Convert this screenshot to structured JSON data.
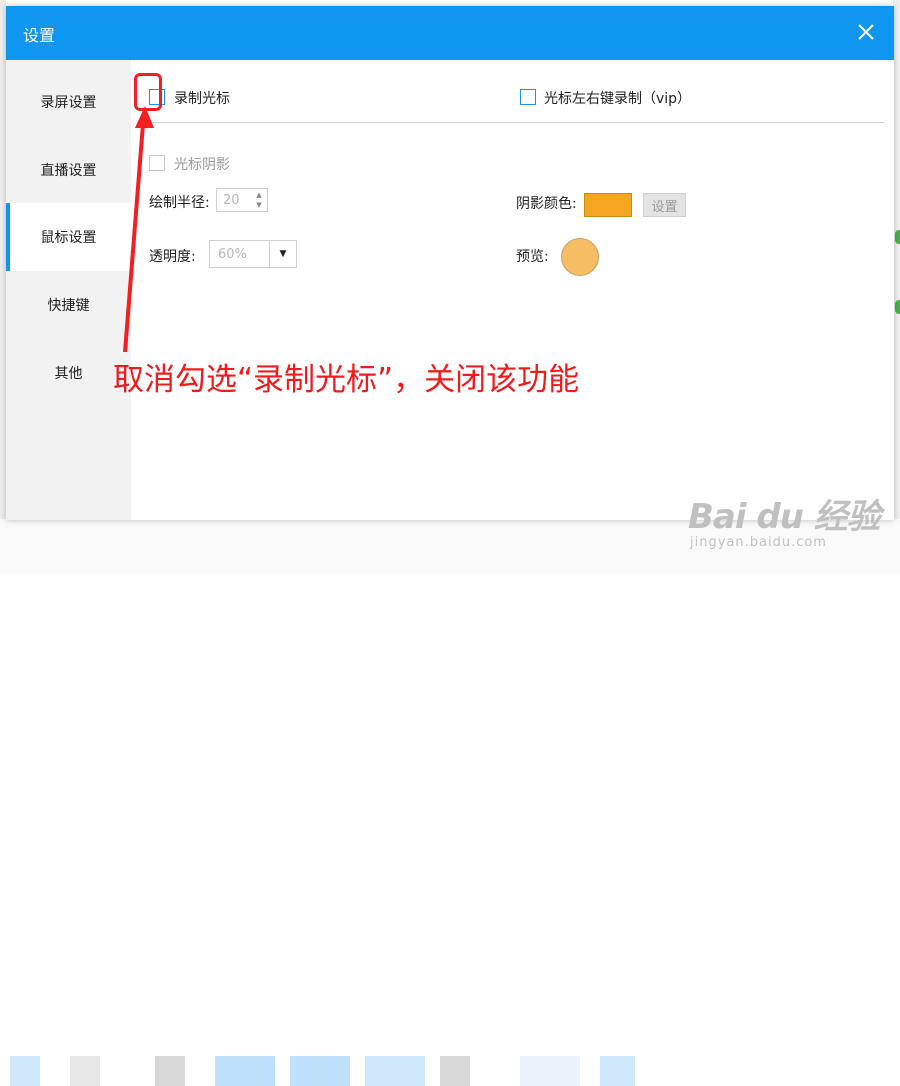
{
  "dialog": {
    "title": "设置",
    "close_icon": "close-icon"
  },
  "sidebar": {
    "items": [
      {
        "label": "录屏设置",
        "active": false
      },
      {
        "label": "直播设置",
        "active": false
      },
      {
        "label": "鼠标设置",
        "active": true
      },
      {
        "label": "快捷键",
        "active": false
      },
      {
        "label": "其他",
        "active": false
      }
    ]
  },
  "main": {
    "record_cursor": {
      "label": "录制光标",
      "checked": false
    },
    "lr_click_record": {
      "label": "光标左右键录制（vip）",
      "checked": false
    },
    "cursor_shadow": {
      "label": "光标阴影",
      "checked": false,
      "disabled": true
    },
    "draw_radius": {
      "label": "绘制半径:",
      "value": "20"
    },
    "opacity": {
      "label": "透明度:",
      "value": "60%"
    },
    "shadow_color": {
      "label": "阴影颜色:",
      "color": "#f5a623",
      "button_label": "设置"
    },
    "preview": {
      "label": "预览:",
      "color": "#f7bd64"
    }
  },
  "annotation": {
    "text": "取消勾选“录制光标”，关闭该功能",
    "color": "#ee1c1c"
  },
  "watermark": {
    "brand": "Bai du 经验",
    "url": "jingyan.baidu.com"
  },
  "colors": {
    "titlebar": "#0f96f0",
    "accent": "#0f96f0"
  }
}
